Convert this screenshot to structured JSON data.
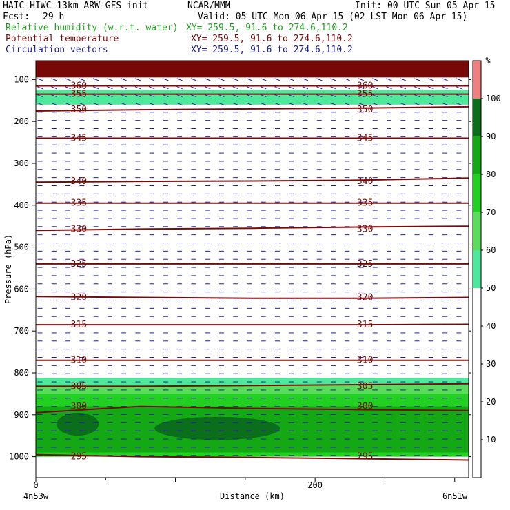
{
  "header": {
    "model_line": "HAIC-HIWC 13km ARW-GFS init",
    "org": "NCAR/MMM",
    "init": "Init: 00 UTC Sun 05 Apr 15",
    "fcst_label": "Fcst:",
    "fcst_value": "29 h",
    "valid": "Valid: 05 UTC Mon 06 Apr 15 (02 LST Mon 06 Apr 15)",
    "field1": "Relative humidity (w.r.t. water)",
    "field1_xy": "XY= 259.5, 91.6 to 274.6,110.2",
    "field2": "Potential temperature",
    "field2_xy": "XY= 259.5, 91.6 to 274.6,110.2",
    "field3": "Circulation vectors",
    "field3_xy": "XY= 259.5, 91.6 to 274.6,110.2"
  },
  "colors": {
    "rh_50_60": "#4ee89a",
    "rh_60_70": "#5cdc5c",
    "rh_70_80": "#22d022",
    "rh_80_90": "#14a814",
    "rh_90_100": "#0a6e1a",
    "rh_100_plus": "#f08080",
    "theta_line": "#7a0a0a",
    "top_fill": "#780808",
    "vectors": "#2020a0"
  },
  "chart_data": {
    "type": "cross-section",
    "title": "",
    "xlabel": "Distance (km)",
    "ylabel": "Pressure (hPa)",
    "xlim": [
      0,
      310
    ],
    "ylim": [
      1050,
      55
    ],
    "y_ticks": [
      "100",
      "200",
      "300",
      "400",
      "500",
      "600",
      "700",
      "800",
      "900",
      "1000"
    ],
    "x_ticks": [
      "0",
      "200"
    ],
    "x_end_labels": [
      "4n53w",
      "6n51w"
    ],
    "colorbar": {
      "unit": "%",
      "ticks": [
        "10",
        "20",
        "30",
        "40",
        "50",
        "60",
        "70",
        "80",
        "90",
        "100"
      ],
      "bins": [
        {
          "min": 50,
          "max": 60,
          "color": "#4ee89a"
        },
        {
          "min": 60,
          "max": 70,
          "color": "#5cdc5c"
        },
        {
          "min": 70,
          "max": 80,
          "color": "#22d022"
        },
        {
          "min": 80,
          "max": 90,
          "color": "#14a814"
        },
        {
          "min": 90,
          "max": 100,
          "color": "#0a6e1a"
        },
        {
          "min": 100,
          "max": 110,
          "color": "#f08080"
        }
      ]
    },
    "theta_contours": [
      {
        "label": "295",
        "pressure": [
          995,
          1000,
          1002,
          1005,
          1008
        ]
      },
      {
        "label": "300",
        "pressure": [
          895,
          880,
          885,
          888,
          890
        ]
      },
      {
        "label": "305",
        "pressure": [
          832,
          832,
          830,
          828,
          826
        ]
      },
      {
        "label": "310",
        "pressure": [
          770,
          770,
          770,
          770,
          770
        ]
      },
      {
        "label": "315",
        "pressure": [
          685,
          685,
          685,
          685,
          684
        ]
      },
      {
        "label": "320",
        "pressure": [
          618,
          620,
          622,
          622,
          620
        ]
      },
      {
        "label": "325",
        "pressure": [
          540,
          540,
          540,
          540,
          540
        ]
      },
      {
        "label": "330",
        "pressure": [
          460,
          457,
          455,
          452,
          450
        ]
      },
      {
        "label": "335",
        "pressure": [
          395,
          395,
          395,
          395,
          395
        ]
      },
      {
        "label": "340",
        "pressure": [
          345,
          343,
          342,
          340,
          335
        ]
      },
      {
        "label": "345",
        "pressure": [
          240,
          240,
          240,
          240,
          240
        ]
      },
      {
        "label": "350",
        "pressure": [
          175,
          172,
          170,
          168,
          165
        ]
      },
      {
        "label": "355",
        "pressure": [
          135,
          135,
          135,
          135,
          135
        ]
      },
      {
        "label": "360",
        "pressure": [
          115,
          115,
          115,
          115,
          115
        ]
      }
    ],
    "theta_contour_x": [
      0,
      75,
      155,
      235,
      310
    ],
    "rh_regions": [
      {
        "name": "upper moist layer 50-60",
        "bin": "50-60",
        "x": [
          0,
          310
        ],
        "p_top": 125,
        "p_bottom": 160
      },
      {
        "name": "low-level 50-60",
        "bin": "50-60",
        "x": [
          0,
          310
        ],
        "p_top": 812,
        "p_bottom": 835
      },
      {
        "name": "low-level 60-70",
        "bin": "60-70",
        "x": [
          0,
          310
        ],
        "p_top": 830,
        "p_bottom": 1000
      },
      {
        "name": "low-level 70-80",
        "bin": "70-80",
        "x": [
          0,
          310
        ],
        "p_top": 850,
        "p_bottom": 1000
      },
      {
        "name": "low-level 80-90",
        "bin": "80-90",
        "x": [
          0,
          310
        ],
        "p_top": 880,
        "p_bottom": 990
      },
      {
        "name": "core 90-100 west",
        "bin": "90-100",
        "x": [
          15,
          45
        ],
        "p_top": 895,
        "p_bottom": 950
      },
      {
        "name": "core 90-100 central",
        "bin": "90-100",
        "x": [
          85,
          175
        ],
        "p_top": 905,
        "p_bottom": 960
      }
    ]
  }
}
